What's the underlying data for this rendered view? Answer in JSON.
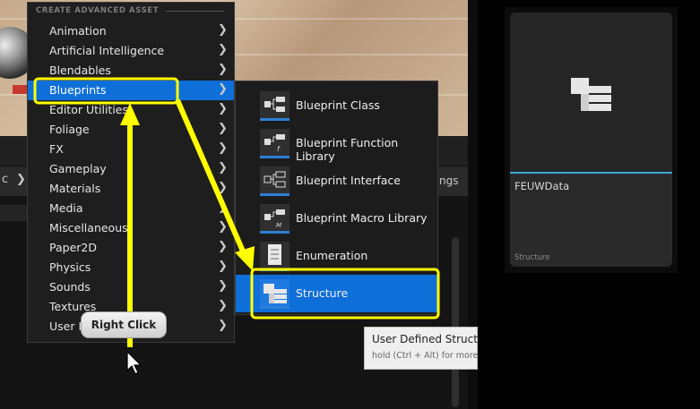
{
  "menu": {
    "header": "CREATE ADVANCED ASSET",
    "items": [
      {
        "label": "Animation"
      },
      {
        "label": "Artificial Intelligence"
      },
      {
        "label": "Blendables"
      },
      {
        "label": "Blueprints"
      },
      {
        "label": "Editor Utilities"
      },
      {
        "label": "Foliage"
      },
      {
        "label": "FX"
      },
      {
        "label": "Gameplay"
      },
      {
        "label": "Materials"
      },
      {
        "label": "Media"
      },
      {
        "label": "Miscellaneous"
      },
      {
        "label": "Paper2D"
      },
      {
        "label": "Physics"
      },
      {
        "label": "Sounds"
      },
      {
        "label": "Textures"
      },
      {
        "label": "User I"
      }
    ],
    "selected": "Blueprints"
  },
  "submenu": {
    "items": [
      {
        "label": "Blueprint Class",
        "icon": "blueprint-class-icon"
      },
      {
        "label": "Blueprint Function Library",
        "icon": "blueprint-function-library-icon"
      },
      {
        "label": "Blueprint Interface",
        "icon": "blueprint-interface-icon"
      },
      {
        "label": "Blueprint Macro Library",
        "icon": "blueprint-macro-library-icon"
      },
      {
        "label": "Enumeration",
        "icon": "enumeration-icon"
      },
      {
        "label": "Structure",
        "icon": "structure-icon"
      }
    ],
    "selected": "Structure"
  },
  "tooltip": {
    "title": "User Defined Struct",
    "hint": "hold (Ctrl + Alt) for more"
  },
  "callout": {
    "label": "Right Click"
  },
  "toolbar": {
    "right_label": "tings",
    "left_glyph": "c",
    "chevron": "❯"
  },
  "asset": {
    "name": "FEUWData",
    "type": "Structure",
    "icon": "structure-icon"
  },
  "arrow_glyph": "❯",
  "colors": {
    "highlight_yellow": "#ffff00",
    "selection_blue": "#0f6fd9",
    "asset_accent": "#3aa8d8"
  }
}
